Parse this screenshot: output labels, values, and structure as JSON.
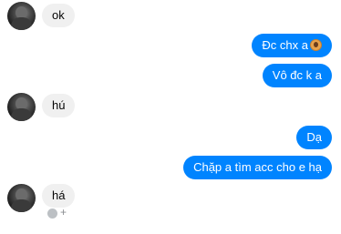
{
  "messages": [
    {
      "side": "incoming",
      "text": "ok"
    },
    {
      "side": "outgoing",
      "text": "Đc chx a"
    },
    {
      "side": "outgoing",
      "text": "Vô đc k a"
    },
    {
      "side": "incoming",
      "text": "hú"
    },
    {
      "side": "outgoing",
      "text": "Dạ"
    },
    {
      "side": "outgoing",
      "text": "Chặp a tìm acc cho e hạ"
    },
    {
      "side": "incoming",
      "text": "há"
    }
  ],
  "reaction_bar": {
    "add_symbol": "+"
  },
  "colors": {
    "outgoing_bubble": "#0084ff",
    "incoming_bubble": "#f0f0f0",
    "background": "#ffffff"
  },
  "icons": {
    "avatar": "contact-avatar",
    "sticker_emoji": "girl-emoji-icon",
    "reaction": "smiley-icon"
  }
}
